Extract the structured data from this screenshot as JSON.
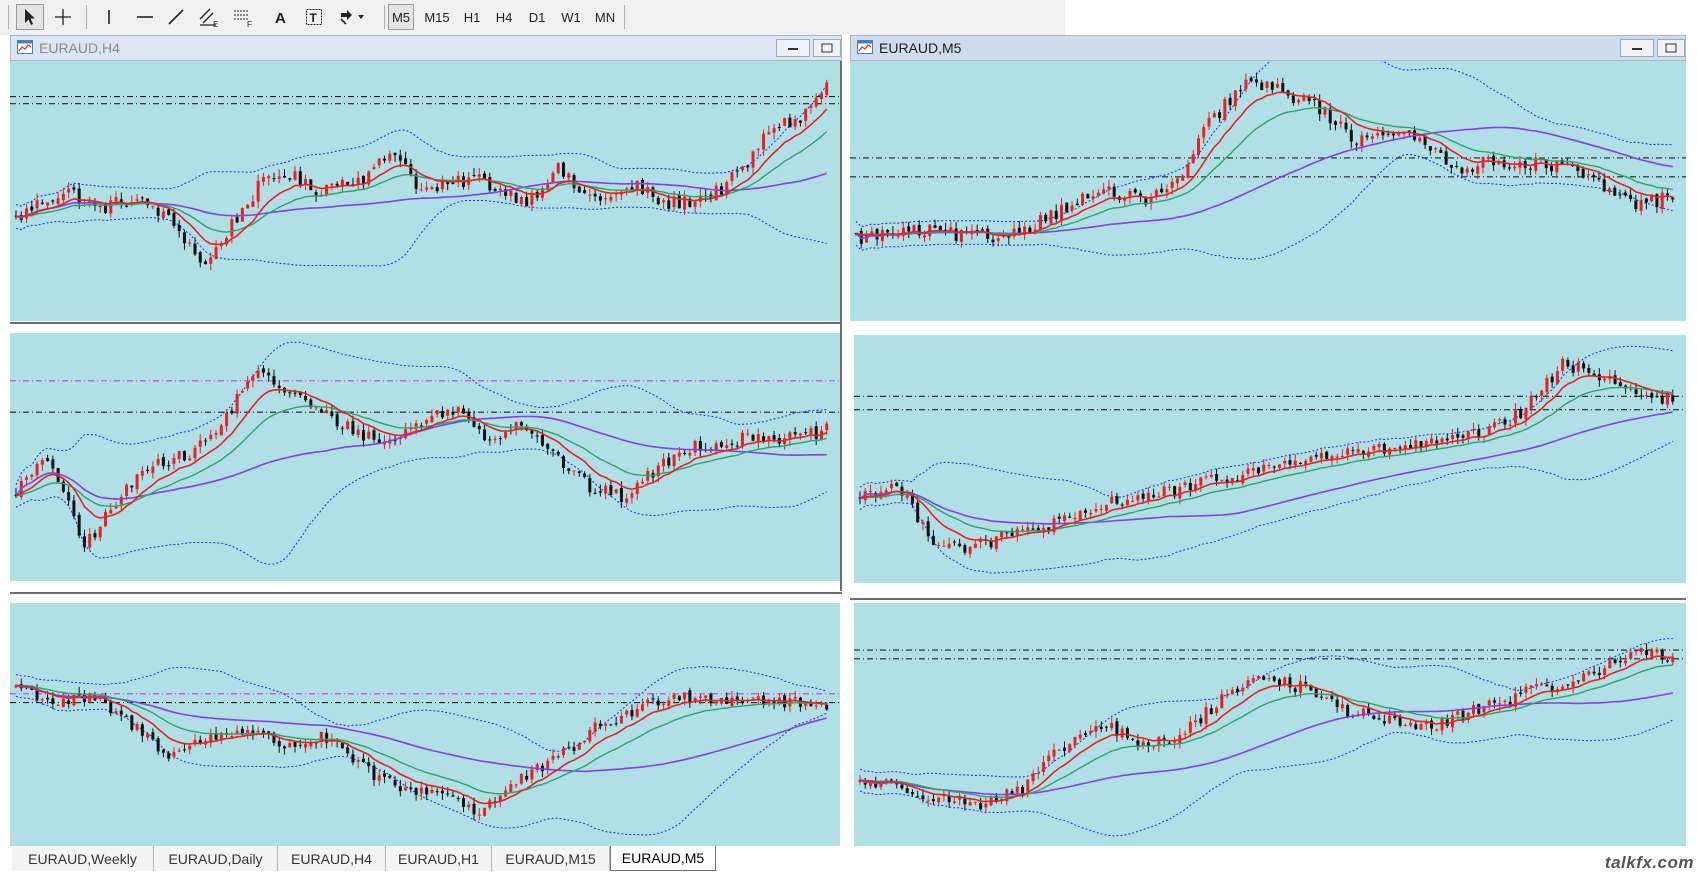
{
  "toolbar": {
    "tools": [
      {
        "name": "cursor-arrow-icon"
      },
      {
        "name": "crosshair-icon"
      },
      {
        "name": "vertical-line-icon"
      },
      {
        "name": "horizontal-line-icon"
      },
      {
        "name": "trendline-icon"
      },
      {
        "name": "equidistant-channel-icon",
        "sub": "E"
      },
      {
        "name": "fibonacci-retracement-icon",
        "sub": "F"
      },
      {
        "name": "text-icon",
        "text": "A"
      },
      {
        "name": "text-label-icon",
        "text": "T"
      },
      {
        "name": "arrows-dropdown-icon"
      }
    ],
    "timeframes": [
      "M5",
      "M15",
      "H1",
      "H4",
      "D1",
      "W1",
      "MN"
    ],
    "active_timeframe": "M5"
  },
  "windows": [
    {
      "id": "h4",
      "title": "EURAUD,H4",
      "active": false
    },
    {
      "id": "m5",
      "title": "EURAUD,M5",
      "active": true
    }
  ],
  "tabs": [
    "EURAUD,Weekly",
    "EURAUD,Daily",
    "EURAUD,H4",
    "EURAUD,H1",
    "EURAUD,M15",
    "EURAUD,M5"
  ],
  "active_tab": "EURAUD,M5",
  "watermark": "talkfx.com",
  "colors": {
    "chart_bg": "#b0dfe6",
    "bull_candle": "#e8231f",
    "bear_candle": "#111111",
    "ma_fast": "#e8231f",
    "ma_mid": "#2ea36b",
    "ma_slow": "#8a3fe0",
    "bands": "#1d2fe0",
    "level_line": "#222222",
    "level_line_magenta": "#e035e0"
  },
  "charts": [
    {
      "id": "p1",
      "shape": [
        0.38,
        0.46,
        0.5,
        0.42,
        0.46,
        0.44,
        0.34,
        0.18,
        0.36,
        0.52,
        0.58,
        0.5,
        0.54,
        0.56,
        0.68,
        0.5,
        0.52,
        0.56,
        0.5,
        0.46,
        0.6,
        0.48,
        0.47,
        0.52,
        0.44,
        0.46,
        0.5,
        0.6,
        0.78,
        0.8,
        0.95
      ],
      "levels": [
        {
          "y": 0.87,
          "color": "level_line"
        },
        {
          "y": 0.9,
          "color": "level_line"
        }
      ]
    },
    {
      "id": "p2",
      "shape": [
        0.35,
        0.5,
        0.1,
        0.3,
        0.48,
        0.5,
        0.62,
        0.88,
        0.8,
        0.7,
        0.62,
        0.56,
        0.66,
        0.72,
        0.58,
        0.66,
        0.5,
        0.36,
        0.32,
        0.45,
        0.55,
        0.56,
        0.6,
        0.58,
        0.62
      ],
      "levels": [
        {
          "y": 0.84,
          "color": "level_line_magenta"
        },
        {
          "y": 0.7,
          "color": "level_line"
        }
      ]
    },
    {
      "id": "p3",
      "shape": [
        0.68,
        0.6,
        0.62,
        0.5,
        0.36,
        0.44,
        0.48,
        0.4,
        0.44,
        0.3,
        0.2,
        0.2,
        0.1,
        0.24,
        0.34,
        0.48,
        0.56,
        0.64,
        0.62,
        0.62,
        0.6,
        0.58
      ],
      "levels": [
        {
          "y": 0.64,
          "color": "level_line_magenta"
        },
        {
          "y": 0.6,
          "color": "level_line"
        }
      ]
    },
    {
      "id": "p4",
      "shape": [
        0.3,
        0.32,
        0.33,
        0.31,
        0.3,
        0.36,
        0.44,
        0.5,
        0.46,
        0.52,
        0.8,
        0.96,
        0.92,
        0.86,
        0.72,
        0.76,
        0.7,
        0.6,
        0.62,
        0.62,
        0.6,
        0.52,
        0.44,
        0.48
      ],
      "levels": [
        {
          "y": 0.64,
          "color": "level_line"
        },
        {
          "y": 0.56,
          "color": "level_line"
        }
      ]
    },
    {
      "id": "p5",
      "shape": [
        0.34,
        0.38,
        0.14,
        0.1,
        0.16,
        0.2,
        0.24,
        0.32,
        0.34,
        0.38,
        0.42,
        0.46,
        0.5,
        0.52,
        0.54,
        0.56,
        0.58,
        0.62,
        0.72,
        0.92,
        0.88,
        0.8,
        0.76
      ],
      "levels": [
        {
          "y": 0.78,
          "color": "level_line"
        },
        {
          "y": 0.72,
          "color": "level_line"
        }
      ]
    },
    {
      "id": "p6",
      "shape": [
        0.24,
        0.22,
        0.16,
        0.14,
        0.2,
        0.4,
        0.5,
        0.4,
        0.46,
        0.64,
        0.72,
        0.66,
        0.56,
        0.52,
        0.48,
        0.56,
        0.62,
        0.68,
        0.72,
        0.84,
        0.8
      ],
      "levels": [
        {
          "y": 0.84,
          "color": "level_line"
        },
        {
          "y": 0.8,
          "color": "level_line"
        }
      ]
    }
  ]
}
